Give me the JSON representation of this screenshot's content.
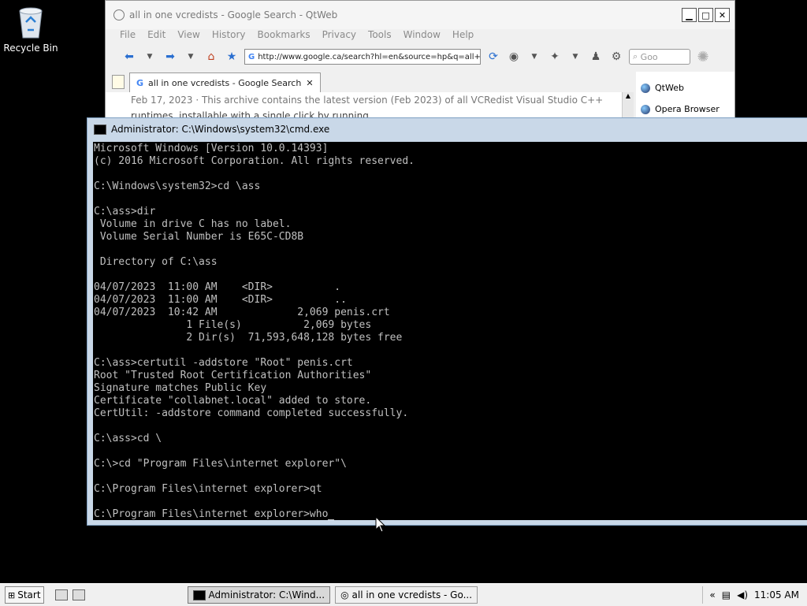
{
  "desktop": {
    "recycle_bin_label": "Recycle Bin"
  },
  "browser": {
    "title": "all in one vcredists - Google Search - QtWeb",
    "menu": [
      "File",
      "Edit",
      "View",
      "History",
      "Bookmarks",
      "Privacy",
      "Tools",
      "Window",
      "Help"
    ],
    "url": "http://www.google.ca/search?hl=en&source=hp&q=all+",
    "search_placeholder": "Goo",
    "tab_label": "all in one vcredists - Google Search",
    "content_line1": "Feb 17, 2023 · This archive contains the latest version (Feb 2023) of all VCRedist Visual Studio C++",
    "content_line2": "runtimes, installable with a single click by running ...",
    "side_items": [
      "QtWeb",
      "Opera Browser"
    ]
  },
  "cmd": {
    "title": "Administrator: C:\\Windows\\system32\\cmd.exe",
    "lines": [
      "Microsoft Windows [Version 10.0.14393]",
      "(c) 2016 Microsoft Corporation. All rights reserved.",
      "",
      "C:\\Windows\\system32>cd \\ass",
      "",
      "C:\\ass>dir",
      " Volume in drive C has no label.",
      " Volume Serial Number is E65C-CD8B",
      "",
      " Directory of C:\\ass",
      "",
      "04/07/2023  11:00 AM    <DIR>          .",
      "04/07/2023  11:00 AM    <DIR>          ..",
      "04/07/2023  10:42 AM             2,069 penis.crt",
      "               1 File(s)          2,069 bytes",
      "               2 Dir(s)  71,593,648,128 bytes free",
      "",
      "C:\\ass>certutil -addstore \"Root\" penis.crt",
      "Root \"Trusted Root Certification Authorities\"",
      "Signature matches Public Key",
      "Certificate \"collabnet.local\" added to store.",
      "CertUtil: -addstore command completed successfully.",
      "",
      "C:\\ass>cd \\",
      "",
      "C:\\>cd \"Program Files\\internet explorer\"\\",
      "",
      "C:\\Program Files\\internet explorer>qt",
      ""
    ],
    "current_prompt": "C:\\Program Files\\internet explorer>who"
  },
  "taskbar": {
    "start_label": "Start",
    "tasks": [
      "Administrator: C:\\Wind...",
      "all in one vcredists - Go..."
    ],
    "tray_chevron": "«",
    "clock": "11:05 AM"
  }
}
